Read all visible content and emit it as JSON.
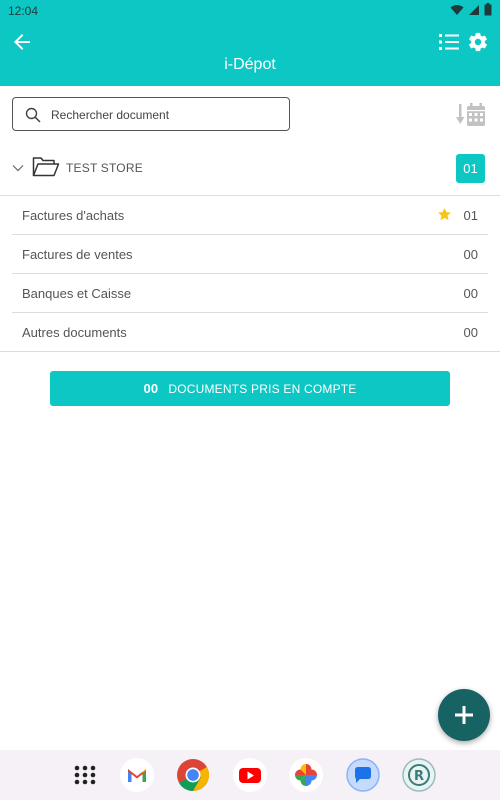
{
  "status_bar": {
    "time": "12:04"
  },
  "app_bar": {
    "title": "i-Dépot"
  },
  "search": {
    "placeholder": "Rechercher document"
  },
  "folder": {
    "name": "TEST STORE",
    "count": "01"
  },
  "categories": [
    {
      "label": "Factures d'achats",
      "count": "01",
      "starred": true
    },
    {
      "label": "Factures de ventes",
      "count": "00"
    },
    {
      "label": "Banques et Caisse",
      "count": "00"
    },
    {
      "label": "Autres documents",
      "count": "00"
    }
  ],
  "summary": {
    "count": "00",
    "label": "DOCUMENTS PRIS EN COMPTE"
  },
  "dock": {
    "apps": [
      "app-drawer-icon",
      "gmail-icon",
      "chrome-icon",
      "youtube-icon",
      "photos-icon",
      "messages-icon",
      "cr-app-icon"
    ]
  },
  "colors": {
    "primary": "#0cc7c4",
    "fab": "#176363",
    "star": "#f5c518"
  }
}
